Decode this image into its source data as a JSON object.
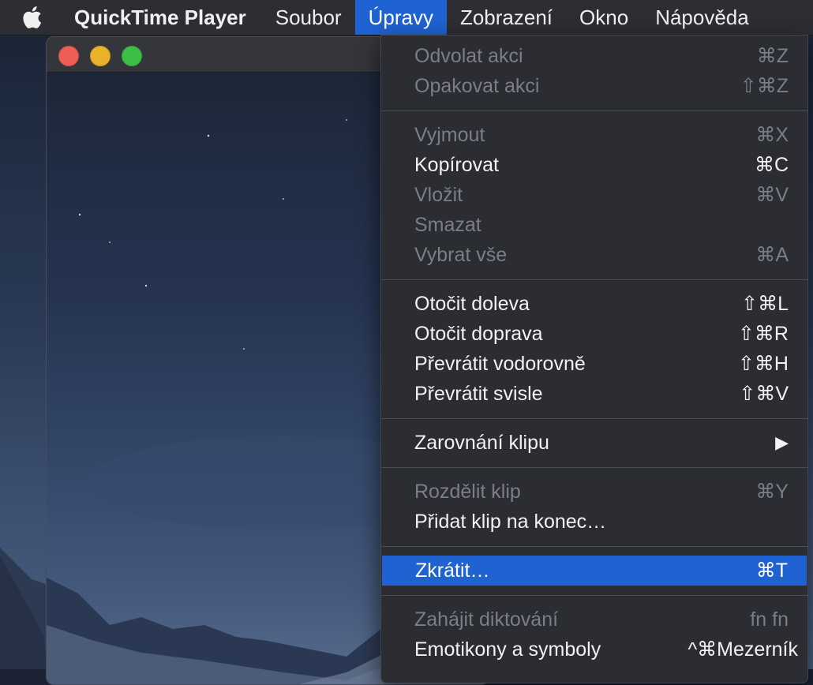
{
  "menubar": {
    "app_name": "QuickTime Player",
    "items": [
      "Soubor",
      "Úpravy",
      "Zobrazení",
      "Okno",
      "Nápověda"
    ],
    "active": "Úpravy"
  },
  "menu": {
    "undo": {
      "label": "Odvolat akci",
      "shortcut": "⌘Z",
      "enabled": false
    },
    "redo": {
      "label": "Opakovat akci",
      "shortcut": "⇧⌘Z",
      "enabled": false
    },
    "cut": {
      "label": "Vyjmout",
      "shortcut": "⌘X",
      "enabled": false
    },
    "copy": {
      "label": "Kopírovat",
      "shortcut": "⌘C",
      "enabled": true
    },
    "paste": {
      "label": "Vložit",
      "shortcut": "⌘V",
      "enabled": false
    },
    "delete": {
      "label": "Smazat",
      "shortcut": "",
      "enabled": false
    },
    "select_all": {
      "label": "Vybrat vše",
      "shortcut": "⌘A",
      "enabled": false
    },
    "rotate_left": {
      "label": "Otočit doleva",
      "shortcut": "⇧⌘L",
      "enabled": true
    },
    "rotate_right": {
      "label": "Otočit doprava",
      "shortcut": "⇧⌘R",
      "enabled": true
    },
    "flip_h": {
      "label": "Převrátit vodorovně",
      "shortcut": "⇧⌘H",
      "enabled": true
    },
    "flip_v": {
      "label": "Převrátit svisle",
      "shortcut": "⇧⌘V",
      "enabled": true
    },
    "clip_align": {
      "label": "Zarovnání klipu",
      "shortcut": "▶",
      "enabled": true
    },
    "split_clip": {
      "label": "Rozdělit klip",
      "shortcut": "⌘Y",
      "enabled": false
    },
    "add_clip": {
      "label": "Přidat klip na konec…",
      "shortcut": "",
      "enabled": true
    },
    "trim": {
      "label": "Zkrátit…",
      "shortcut": "⌘T",
      "enabled": true,
      "highlighted": true
    },
    "dictation": {
      "label": "Zahájit diktování",
      "shortcut": "fn fn",
      "enabled": false
    },
    "emoji": {
      "label": "Emotikony a symboly",
      "shortcut": "^⌘Mezerník",
      "enabled": true
    }
  },
  "colors": {
    "highlight": "#1f62d1",
    "menu_bg": "#2b2d33",
    "disabled_text": "#7b7e86"
  }
}
